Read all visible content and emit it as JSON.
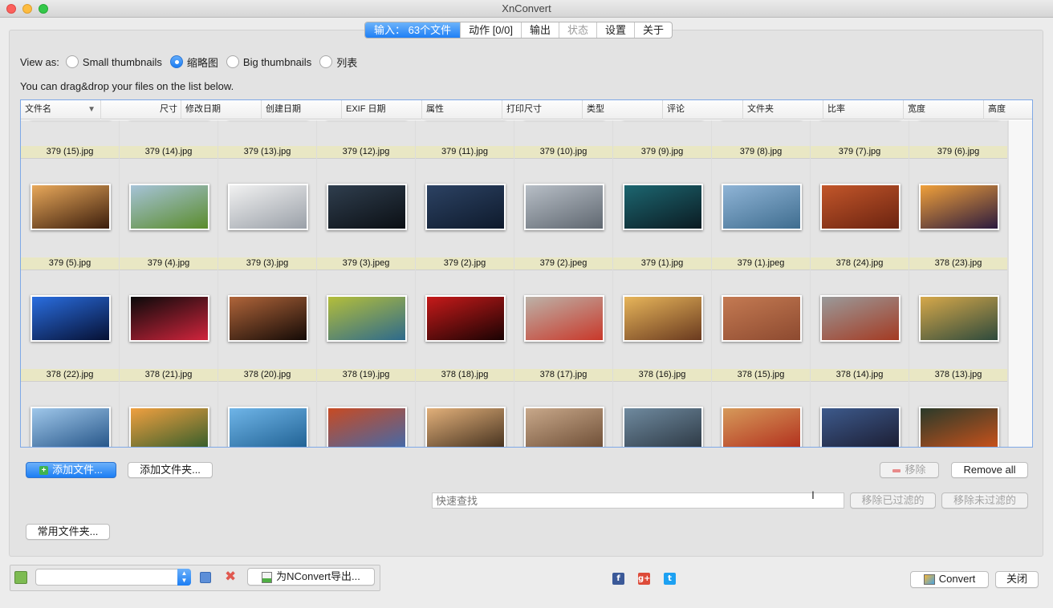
{
  "window": {
    "title": "XnConvert"
  },
  "tabs": [
    {
      "label": "输入： 63个文件",
      "state": "active"
    },
    {
      "label": "动作 [0/0]",
      "state": "normal"
    },
    {
      "label": "输出",
      "state": "normal"
    },
    {
      "label": "状态",
      "state": "disabled"
    },
    {
      "label": "设置",
      "state": "normal"
    },
    {
      "label": "关于",
      "state": "normal"
    }
  ],
  "view_as": {
    "label": "View as:",
    "options": [
      "Small thumbnails",
      "缩略图",
      "Big thumbnails",
      "列表"
    ],
    "selected": "缩略图"
  },
  "hint": "You can drag&drop your files on the list below.",
  "columns": [
    "文件名",
    "尺寸",
    "修改日期",
    "创建日期",
    "EXIF 日期",
    "属性",
    "打印尺寸",
    "类型",
    "评论",
    "文件夹",
    "比率",
    "宽度",
    "高度"
  ],
  "sort_indicator": "▼",
  "files": [
    {
      "name": "379 (15).jpg",
      "colors": [
        "#cfcfcf",
        "#a0a0a0"
      ]
    },
    {
      "name": "379 (14).jpg",
      "colors": [
        "#cfcfcf",
        "#a0a0a0"
      ]
    },
    {
      "name": "379 (13).jpg",
      "colors": [
        "#cfcfcf",
        "#a0a0a0"
      ]
    },
    {
      "name": "379 (12).jpg",
      "colors": [
        "#cfcfcf",
        "#a0a0a0"
      ]
    },
    {
      "name": "379 (11).jpg",
      "colors": [
        "#cfcfcf",
        "#a0a0a0"
      ]
    },
    {
      "name": "379 (10).jpg",
      "colors": [
        "#cfcfcf",
        "#a0a0a0"
      ]
    },
    {
      "name": "379 (9).jpg",
      "colors": [
        "#cfcfcf",
        "#a0a0a0"
      ]
    },
    {
      "name": "379 (8).jpg",
      "colors": [
        "#cfcfcf",
        "#a0a0a0"
      ]
    },
    {
      "name": "379 (7).jpg",
      "colors": [
        "#cfcfcf",
        "#a0a0a0"
      ]
    },
    {
      "name": "379 (6).jpg",
      "colors": [
        "#cfcfcf",
        "#a0a0a0"
      ]
    },
    {
      "name": "379 (5).jpg",
      "colors": [
        "#e8a85a",
        "#3b1d0c"
      ]
    },
    {
      "name": "379 (4).jpg",
      "colors": [
        "#a6c3d8",
        "#5a8c2b"
      ]
    },
    {
      "name": "379 (3).jpg",
      "colors": [
        "#f1f1f1",
        "#9aa0a8"
      ]
    },
    {
      "name": "379 (3).jpeg",
      "colors": [
        "#2f3e4e",
        "#0b0f14"
      ]
    },
    {
      "name": "379 (2).jpg",
      "colors": [
        "#2c4263",
        "#0e1a2c"
      ]
    },
    {
      "name": "379 (2).jpeg",
      "colors": [
        "#b7bec6",
        "#5f6770"
      ]
    },
    {
      "name": "379 (1).jpg",
      "colors": [
        "#1c6670",
        "#0b1b22"
      ]
    },
    {
      "name": "379 (1).jpeg",
      "colors": [
        "#8fb4d6",
        "#3f6d8f"
      ]
    },
    {
      "name": "378 (24).jpg",
      "colors": [
        "#c2562a",
        "#6b2310"
      ]
    },
    {
      "name": "378 (23).jpg",
      "colors": [
        "#f0a03a",
        "#2b1a3e"
      ]
    },
    {
      "name": "378 (22).jpg",
      "colors": [
        "#2a6ee0",
        "#061033"
      ]
    },
    {
      "name": "378 (21).jpg",
      "colors": [
        "#0a0a0a",
        "#d0243c"
      ]
    },
    {
      "name": "378 (20).jpg",
      "colors": [
        "#b0653a",
        "#140a06"
      ]
    },
    {
      "name": "378 (19).jpg",
      "colors": [
        "#b4be3a",
        "#2d6a8c"
      ]
    },
    {
      "name": "378 (18).jpg",
      "colors": [
        "#c61a1a",
        "#1a0303"
      ]
    },
    {
      "name": "378 (17).jpg",
      "colors": [
        "#bcb2a8",
        "#c9382a"
      ]
    },
    {
      "name": "378 (16).jpg",
      "colors": [
        "#e7b55a",
        "#6a3a1f"
      ]
    },
    {
      "name": "378 (15).jpg",
      "colors": [
        "#c47a52",
        "#8d4a30"
      ]
    },
    {
      "name": "378 (14).jpg",
      "colors": [
        "#9a9a9a",
        "#a43a22"
      ]
    },
    {
      "name": "378 (13).jpg",
      "colors": [
        "#d6a84a",
        "#2e4a3c"
      ]
    },
    {
      "name": "",
      "colors": [
        "#9fc7ea",
        "#1f4f83"
      ]
    },
    {
      "name": "",
      "colors": [
        "#f0a040",
        "#2c5a2a"
      ]
    },
    {
      "name": "",
      "colors": [
        "#6fb5e8",
        "#1c5d8f"
      ]
    },
    {
      "name": "",
      "colors": [
        "#c84a22",
        "#3d6bb0"
      ]
    },
    {
      "name": "",
      "colors": [
        "#e2b07a",
        "#3d2b1a"
      ]
    },
    {
      "name": "",
      "colors": [
        "#c8a88a",
        "#6a4a32"
      ]
    },
    {
      "name": "",
      "colors": [
        "#6f8a9f",
        "#2a3540"
      ]
    },
    {
      "name": "",
      "colors": [
        "#d69a5a",
        "#b02a1a"
      ]
    },
    {
      "name": "",
      "colors": [
        "#3d5a8c",
        "#1a1a2e"
      ]
    },
    {
      "name": "",
      "colors": [
        "#2a3a2a",
        "#d2531a"
      ]
    }
  ],
  "buttons": {
    "add_files": "添加文件...",
    "add_folder": "添加文件夹...",
    "remove": "移除",
    "remove_all": "Remove all",
    "remove_filtered": "移除已过滤的",
    "remove_unfiltered": "移除未过滤的",
    "common_folders": "常用文件夹...",
    "export_nconvert": "为NConvert导出...",
    "convert": "Convert",
    "close": "关闭"
  },
  "search": {
    "placeholder": "快速查找",
    "value": ""
  },
  "preset_combo": {
    "value": ""
  },
  "social": [
    {
      "name": "facebook-icon",
      "glyph": "f",
      "color": "#3b5998"
    },
    {
      "name": "google-plus-icon",
      "glyph": "g+",
      "color": "#dd4b39"
    },
    {
      "name": "twitter-icon",
      "glyph": "t",
      "color": "#1da1f2"
    }
  ],
  "colors": {
    "accent": "#1c7ef4",
    "caption_bg": "#e9e7c4",
    "list_border": "#7ea8e6"
  }
}
